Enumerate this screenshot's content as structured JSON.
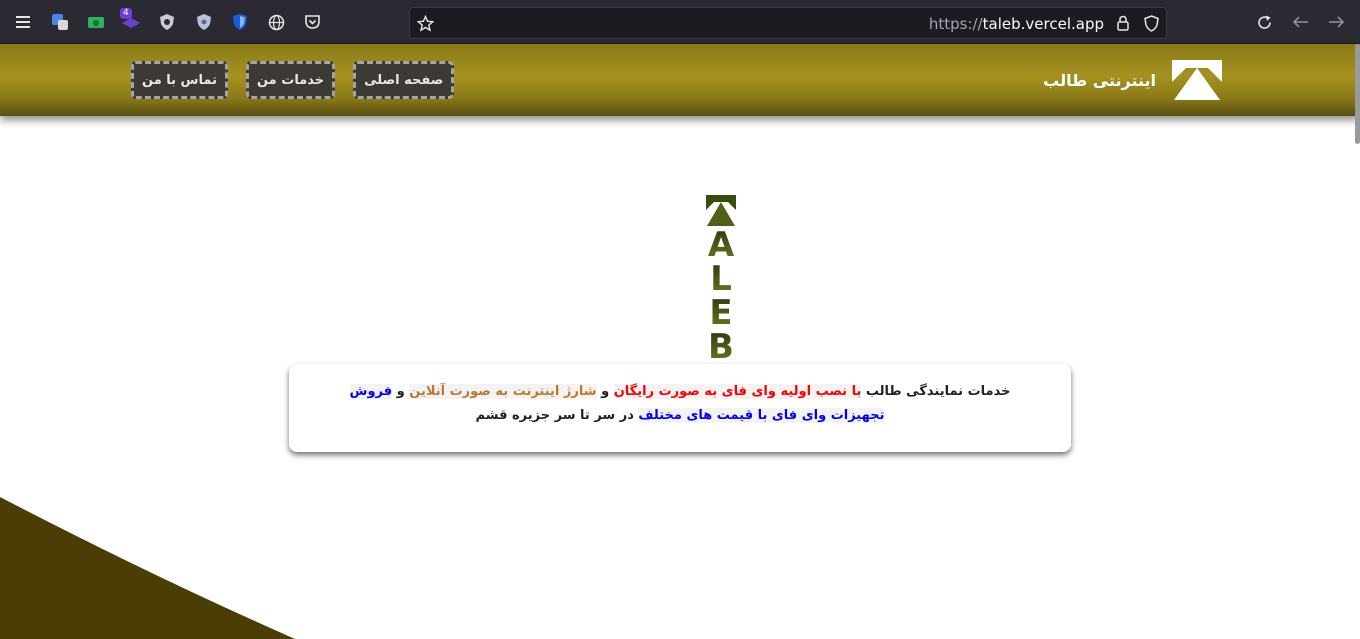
{
  "browser": {
    "url_scheme": "https://",
    "url_host": "taleb.vercel.app",
    "extension_badge": "4",
    "icons": [
      "menu-icon",
      "translate-icon",
      "camera-extension-icon",
      "layers-extension-icon",
      "shield-extension-icon",
      "badge-shield-icon",
      "bitwarden-icon",
      "globe-icon",
      "pocket-icon",
      "star-icon",
      "lock-icon",
      "tracking-shield-icon",
      "reload-icon",
      "back-icon",
      "forward-icon"
    ]
  },
  "header": {
    "brand_name": "اینترنتی طالب",
    "nav": [
      {
        "label": "صفحه اصلی"
      },
      {
        "label": "خدمات من"
      },
      {
        "label": "تماس با من"
      }
    ]
  },
  "hero": {
    "letters": [
      "T",
      "A",
      "L",
      "E",
      "B"
    ]
  },
  "card": {
    "intro": "خدمات نمایندگی طالب",
    "service1": "با نصب اولیه وای فای به صورت رایگان",
    "and1": "و",
    "service2": "شارژ اینترنت به صورت آنلاین",
    "and2": "و",
    "service3": "فروش تجهیزات وای فای با قیمت های مختلف",
    "outro": "در سر تا سر جزیره قشم"
  },
  "colors": {
    "header_gold": "#a5921f",
    "curve_dark": "#4a3d06",
    "nav_bg": "#3d3a36"
  }
}
